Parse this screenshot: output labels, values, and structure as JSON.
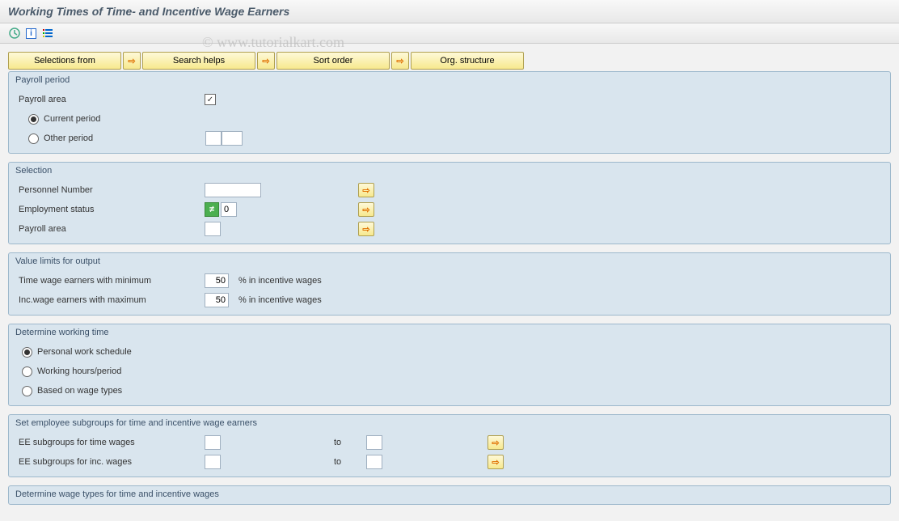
{
  "title": "Working Times of Time- and Incentive Wage Earners",
  "watermark": "© www.tutorialkart.com",
  "toolbarIcons": {
    "execute": "execute-icon",
    "info": "i",
    "list": "list-icon"
  },
  "buttons": {
    "selectionsFrom": "Selections from",
    "searchHelps": "Search helps",
    "sortOrder": "Sort order",
    "orgStructure": "Org. structure"
  },
  "groups": {
    "payrollPeriod": {
      "title": "Payroll period",
      "payrollArea": "Payroll area",
      "payrollAreaChecked": "✓",
      "currentPeriod": "Current period",
      "otherPeriod": "Other period",
      "otherPeriodVal1": "",
      "otherPeriodVal2": ""
    },
    "selection": {
      "title": "Selection",
      "personnelNumber": "Personnel Number",
      "personnelNumberVal": "",
      "employmentStatus": "Employment status",
      "employmentStatusOp": "≠",
      "employmentStatusVal": "0",
      "payrollArea": "Payroll area",
      "payrollAreaVal": ""
    },
    "valueLimits": {
      "title": "Value limits for output",
      "timeWageMin": "Time wage earners with minimum",
      "timeWageMinVal": "50",
      "incWageMax": "Inc.wage earners with maximum",
      "incWageMaxVal": "50",
      "suffix": "%  in incentive wages"
    },
    "determineWorkingTime": {
      "title": "Determine working time",
      "personalSchedule": "Personal work schedule",
      "workingHours": "Working hours/period",
      "wageTypes": "Based on wage types"
    },
    "eeSubgroups": {
      "title": "Set employee subgroups for time and incentive wage earners",
      "timeWages": "EE subgroups for time wages",
      "timeWagesFrom": "",
      "timeWagesTo": "",
      "incWages": "EE subgroups for inc. wages",
      "incWagesFrom": "",
      "incWagesTo": "",
      "toLabel": "to"
    },
    "determineWageTypes": {
      "title": "Determine wage types for time and incentive wages"
    }
  }
}
